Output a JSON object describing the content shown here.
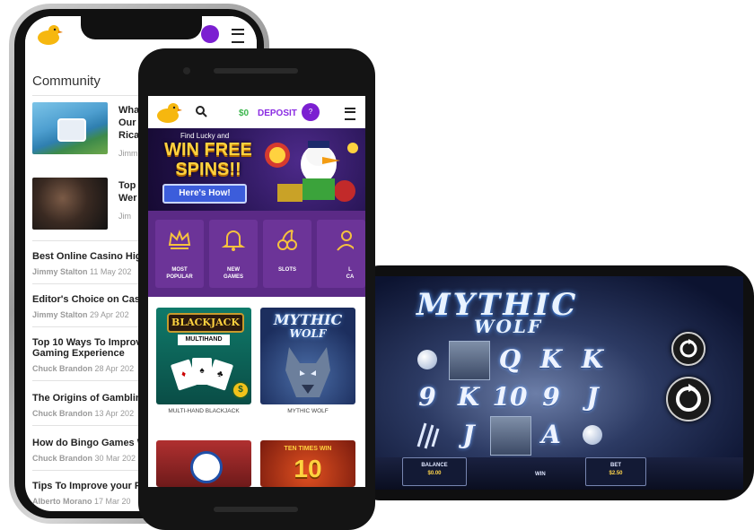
{
  "left_phone": {
    "section_title": "Community",
    "snippets": [
      {
        "lines": [
          "Wha",
          "Our",
          "Rica"
        ],
        "meta": "Jimm"
      },
      {
        "lines": [
          "Top",
          "Wer"
        ],
        "meta": "Jim"
      }
    ],
    "articles": [
      {
        "title": "Best Online Casino Hig",
        "author": "Jimmy Stalton",
        "date": "11 May 202"
      },
      {
        "title": "Editor's Choice on Casi",
        "author": "Jimmy Stalton",
        "date": "29 Apr 202"
      },
      {
        "title": "Top 10 Ways To Improv",
        "title2": "Gaming Experience",
        "author": "Chuck Brandon",
        "date": "28 Apr 202"
      },
      {
        "title": "The Origins of Gamblin",
        "author": "Chuck Brandon",
        "date": "13 Apr 202"
      },
      {
        "title": "How do Bingo Games W",
        "author": "Chuck Brandon",
        "date": "30 Mar 202"
      },
      {
        "title": "Tips To Improve your P",
        "author": "Alberto Morano",
        "date": "17 Mar 20"
      }
    ]
  },
  "front_phone": {
    "header": {
      "balance": "$0",
      "deposit": "DEPOSIT",
      "avatar": "?"
    },
    "banner": {
      "small": "Find Lucky and",
      "line1": "WIN FREE",
      "line2": "SPINS!!",
      "button": "Here's How!"
    },
    "categories": [
      {
        "line1": "MOST",
        "line2": "POPULAR",
        "icon": "crown-icon"
      },
      {
        "line1": "NEW",
        "line2": "GAMES",
        "icon": "bell-icon"
      },
      {
        "line1": "SLOTS",
        "line2": "",
        "icon": "cherries-icon"
      },
      {
        "line1": "L",
        "line2": "CA",
        "icon": "dealer-icon"
      }
    ],
    "games": [
      {
        "name": "MULTI-HAND BLACKJACK",
        "logo1": "BLACKJACK",
        "logo2": "MULTIHAND"
      },
      {
        "name": "MYTHIC WOLF",
        "logo1": "MYTHIC",
        "logo2": "WOLF"
      }
    ],
    "more_games": [
      {
        "badge": "TEN TIMES WIN",
        "number": "10"
      }
    ]
  },
  "landscape_phone": {
    "title1": "MYTHIC",
    "title2": "WOLF",
    "reels": [
      [
        "moon",
        "wolf",
        "Q",
        "K",
        "K"
      ],
      [
        "9",
        "K",
        "10",
        "9",
        "J"
      ],
      [
        "claw",
        "J",
        "wolf",
        "A",
        "moon"
      ]
    ],
    "balance_label": "BALANCE",
    "balance_value": "$0.00",
    "win_label": "WIN",
    "bet_label": "BET",
    "bet_value": "$2.50"
  },
  "colors": {
    "purple": "#5b2a86",
    "accent": "#7b1fd1",
    "gold": "#ffd23f",
    "green": "#3bb64c"
  }
}
